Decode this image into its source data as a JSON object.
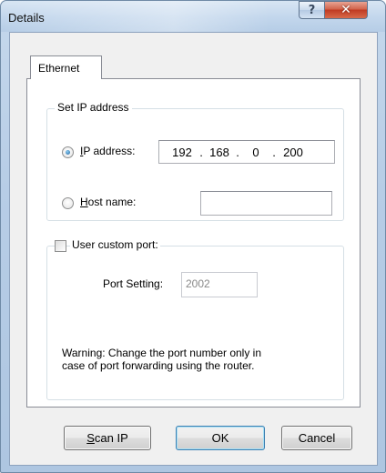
{
  "window": {
    "title": "Details",
    "help_glyph": "?",
    "close_glyph": "✕"
  },
  "tabs": [
    {
      "label": "Ethernet"
    }
  ],
  "ip_group": {
    "legend": "Set IP address",
    "ip_radio": {
      "prefix": "",
      "accel": "I",
      "rest": "P address:",
      "checked": true
    },
    "ip_value": {
      "oct1": "192",
      "oct2": "168",
      "oct3": "0",
      "oct4": "200",
      "sep": "."
    },
    "host_radio": {
      "accel": "H",
      "rest": "ost name:",
      "checked": false
    },
    "host_value": ""
  },
  "port_group": {
    "checkbox_label": "User custom port:",
    "checked": false,
    "port_label": "Port Setting:",
    "port_value": "2002",
    "warning_line1": "Warning: Change the port number only in",
    "warning_line2": "case of port forwarding using the router."
  },
  "buttons": {
    "scan_accel": "S",
    "scan_rest": "can IP",
    "ok": "OK",
    "cancel": "Cancel"
  }
}
